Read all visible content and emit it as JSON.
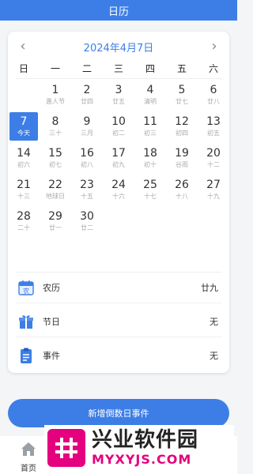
{
  "topbar": {
    "title": "日历"
  },
  "calendar": {
    "month_title": "2024年4月7日",
    "prev_icon": "chevron-left-icon",
    "next_icon": "chevron-right-icon",
    "weekdays": [
      "日",
      "一",
      "二",
      "三",
      "四",
      "五",
      "六"
    ],
    "days": [
      {
        "day": "1",
        "sub": "愚人节"
      },
      {
        "day": "2",
        "sub": "廿四"
      },
      {
        "day": "3",
        "sub": "廿五"
      },
      {
        "day": "4",
        "sub": "清明"
      },
      {
        "day": "5",
        "sub": "廿七"
      },
      {
        "day": "6",
        "sub": "廿八"
      },
      {
        "day": "7",
        "sub": "今天",
        "today": true
      },
      {
        "day": "8",
        "sub": "三十"
      },
      {
        "day": "9",
        "sub": "三月"
      },
      {
        "day": "10",
        "sub": "初二"
      },
      {
        "day": "11",
        "sub": "初三"
      },
      {
        "day": "12",
        "sub": "初四"
      },
      {
        "day": "13",
        "sub": "初五"
      },
      {
        "day": "14",
        "sub": "初六"
      },
      {
        "day": "15",
        "sub": "初七"
      },
      {
        "day": "16",
        "sub": "初八"
      },
      {
        "day": "17",
        "sub": "初九"
      },
      {
        "day": "18",
        "sub": "初十"
      },
      {
        "day": "19",
        "sub": "谷雨"
      },
      {
        "day": "20",
        "sub": "十二"
      },
      {
        "day": "21",
        "sub": "十三"
      },
      {
        "day": "22",
        "sub": "地球日"
      },
      {
        "day": "23",
        "sub": "十五"
      },
      {
        "day": "24",
        "sub": "十六"
      },
      {
        "day": "25",
        "sub": "十七"
      },
      {
        "day": "26",
        "sub": "十八"
      },
      {
        "day": "27",
        "sub": "十九"
      },
      {
        "day": "28",
        "sub": "二十"
      },
      {
        "day": "29",
        "sub": "廿一"
      },
      {
        "day": "30",
        "sub": "廿二"
      }
    ],
    "first_weekday": 1,
    "today_color": "#3d7ee6"
  },
  "info": [
    {
      "icon": "lunar-calendar-icon",
      "label": "农历",
      "value": "廿九"
    },
    {
      "icon": "gift-icon",
      "label": "节日",
      "value": "无"
    },
    {
      "icon": "clipboard-icon",
      "label": "事件",
      "value": "无"
    }
  ],
  "info_icon_text": "农",
  "add_button": {
    "label": "新增倒数日事件"
  },
  "bottom_nav": {
    "home_label": "首页",
    "home_icon": "home-icon"
  },
  "watermark": {
    "cn": "兴业软件园",
    "en": "MYXYJS.COM"
  },
  "colors": {
    "accent": "#3d7ee6",
    "watermark": "#e4007f"
  }
}
